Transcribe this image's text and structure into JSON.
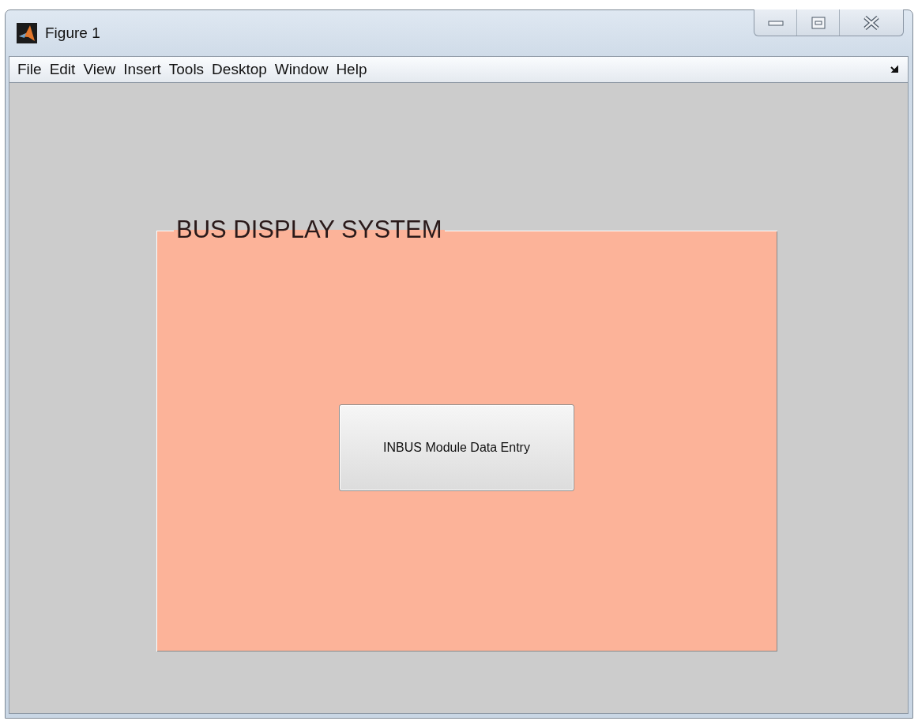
{
  "window": {
    "title": "Figure 1"
  },
  "menu": [
    "File",
    "Edit",
    "View",
    "Insert",
    "Tools",
    "Desktop",
    "Window",
    "Help"
  ],
  "panel": {
    "title": "BUS DISPLAY SYSTEM",
    "button": "INBUS Module Data Entry"
  }
}
